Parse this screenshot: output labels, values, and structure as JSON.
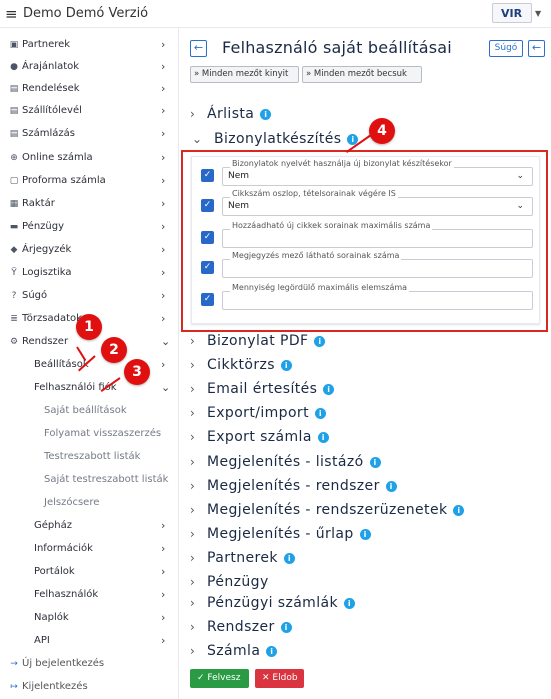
{
  "app": {
    "menu_icon": "≡",
    "title": "Demo Demó Verzió",
    "logo": "VIR"
  },
  "sidebar": {
    "items": [
      {
        "label": "Partnerek",
        "icon": "contact-icon",
        "glyph": "▣"
      },
      {
        "label": "Árajánlatok",
        "icon": "users-icon",
        "glyph": "●"
      },
      {
        "label": "Rendelések",
        "icon": "file-icon",
        "glyph": "▤"
      },
      {
        "label": "Szállítólevél",
        "icon": "file-icon",
        "glyph": "▤"
      },
      {
        "label": "Számlázás",
        "icon": "file-icon",
        "glyph": "▤"
      },
      {
        "label": "Online számla",
        "icon": "globe-icon",
        "glyph": "⊕"
      },
      {
        "label": "Proforma számla",
        "icon": "doc-icon",
        "glyph": "▢"
      },
      {
        "label": "Raktár",
        "icon": "warehouse-icon",
        "glyph": "▦"
      },
      {
        "label": "Pénzügy",
        "icon": "money-icon",
        "glyph": "▬"
      },
      {
        "label": "Árjegyzék",
        "icon": "tag-icon",
        "glyph": "◆"
      },
      {
        "label": "Logisztika",
        "icon": "route-icon",
        "glyph": "Ÿ"
      },
      {
        "label": "Súgó",
        "icon": "question-icon",
        "glyph": "?"
      },
      {
        "label": "Törzsadatok",
        "icon": "database-icon",
        "glyph": "≣"
      },
      {
        "label": "Rendszer",
        "icon": "cogs-icon",
        "glyph": "⚙"
      },
      {
        "label": "Beállítások"
      },
      {
        "label": "Felhasználói fiók"
      },
      {
        "label": "Saját beállítások"
      },
      {
        "label": "Folyamat visszaszerzés"
      },
      {
        "label": "Testreszabott listák"
      },
      {
        "label": "Saját testreszabott listák"
      },
      {
        "label": "Jelszócsere"
      },
      {
        "label": "Gépház"
      },
      {
        "label": "Információk"
      },
      {
        "label": "Portálok"
      },
      {
        "label": "Felhasználók"
      },
      {
        "label": "Naplók"
      },
      {
        "label": "API"
      },
      {
        "label": "Új bejelentkezés",
        "icon": "login-icon",
        "glyph": "→"
      },
      {
        "label": "Kijelentkezés",
        "icon": "logout-icon",
        "glyph": "↦"
      }
    ]
  },
  "main": {
    "back_icon": "←",
    "title": "Felhasználó saját beállításai",
    "help_label": "Súgó",
    "expand_all": "Minden mezőt kinyit",
    "collapse_all": "Minden mezőt becsuk",
    "sections": [
      {
        "label": "Árlista"
      },
      {
        "label": "Bizonylatkészítés"
      },
      {
        "label": "Bizonylat PDF"
      },
      {
        "label": "Cikktörzs"
      },
      {
        "label": "Email értesítés"
      },
      {
        "label": "Export/import"
      },
      {
        "label": "Export számla"
      },
      {
        "label": "Megjelenítés - listázó"
      },
      {
        "label": "Megjelenítés - rendszer"
      },
      {
        "label": "Megjelenítés - rendszerüzenetek"
      },
      {
        "label": "Megjelenítés - űrlap"
      },
      {
        "label": "Partnerek"
      },
      {
        "label": "Pénzügy"
      },
      {
        "label": "Pénzügyi számlák"
      },
      {
        "label": "Rendszer"
      },
      {
        "label": "Számla"
      }
    ],
    "fields": [
      {
        "label": "Bizonylatok nyelvét használja új bizonylat készítésekor",
        "value": "Nem"
      },
      {
        "label": "Cikkszám oszlop, tételsorainak végére IS",
        "value": "Nem"
      },
      {
        "label": "Hozzáadható új cikkek sorainak maximális száma",
        "value": ""
      },
      {
        "label": "Megjegyzés mező látható sorainak száma",
        "value": ""
      },
      {
        "label": "Mennyiség legördülő maximális elemszáma",
        "value": ""
      }
    ],
    "save_label": "Felvesz",
    "discard_label": "Eldob"
  },
  "callouts": [
    "1",
    "2",
    "3",
    "4"
  ],
  "colors": {
    "accent": "#2c6fd2",
    "info": "#1ea1e6",
    "highlight": "#d8281f",
    "save": "#2a9a45",
    "discard": "#d9343f"
  }
}
